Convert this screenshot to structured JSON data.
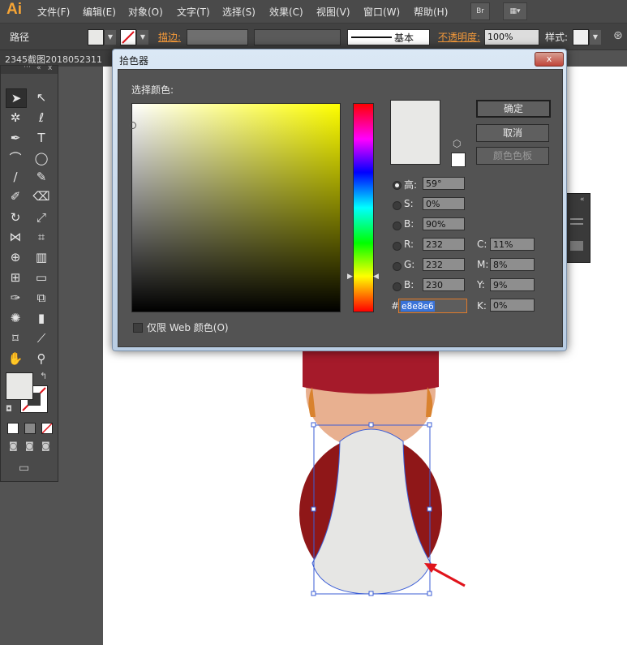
{
  "app": {
    "logo": "Ai",
    "menu": [
      "文件(F)",
      "编辑(E)",
      "对象(O)",
      "文字(T)",
      "选择(S)",
      "效果(C)",
      "视图(V)",
      "窗口(W)",
      "帮助(H)"
    ],
    "bridge_label": "Br"
  },
  "control_bar": {
    "selection_type": "路径",
    "stroke_label": "描边:",
    "stroke_style": "基本",
    "opacity_label": "不透明度:",
    "opacity_value": "100%",
    "style_label": "样式:"
  },
  "document_tab": {
    "title": "2345截图2018052311"
  },
  "dialog": {
    "title": "拾色器",
    "close": "x",
    "select_color_label": "选择颜色:",
    "buttons": {
      "ok": "确定",
      "cancel": "取消",
      "swatches": "颜色色板"
    },
    "fields": {
      "h": {
        "label": "高:",
        "value": "59°"
      },
      "s": {
        "label": "S:",
        "value": "0%"
      },
      "b": {
        "label": "B:",
        "value": "90%"
      },
      "r": {
        "label": "R:",
        "value": "232"
      },
      "g": {
        "label": "G:",
        "value": "232"
      },
      "b2": {
        "label": "B:",
        "value": "230"
      },
      "hex": {
        "label": "#",
        "value": "e8e8e6"
      },
      "c": {
        "label": "C:",
        "value": "11%"
      },
      "m": {
        "label": "M:",
        "value": "8%"
      },
      "y": {
        "label": "Y:",
        "value": "9%"
      },
      "k": {
        "label": "K:",
        "value": "0%"
      }
    },
    "web_only_label": "仅限 Web 颜色(O)",
    "current_color": "#e8e8e6",
    "hue_color": "#ffff00"
  },
  "colors": {
    "fill": "#e8e8e6",
    "hat_red": "#a51a2a",
    "vest_red": "#8f1718",
    "skin": "#e8b090",
    "body": "#e6e6e4",
    "selection": "#3b5dd6",
    "arrow": "#e0141c"
  }
}
